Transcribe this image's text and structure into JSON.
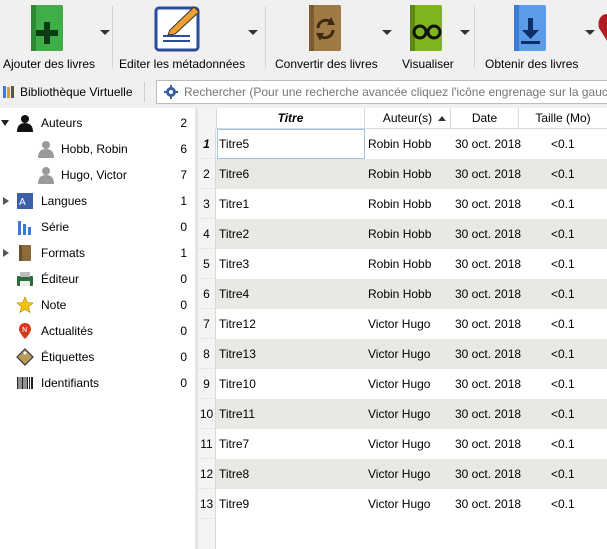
{
  "toolbar": {
    "add_label": "Ajouter des livres",
    "edit_label": "Editer les métadonnées",
    "convert_label": "Convertir des livres",
    "view_label": "Visualiser",
    "get_label": "Obtenir des livres"
  },
  "search": {
    "vlib_label": "Bibliothèque Virtuelle",
    "placeholder": "Rechercher (Pour une recherche avancée cliquez l'icône engrenage sur la gauche)"
  },
  "sidebar": {
    "items": [
      {
        "label": "Auteurs",
        "count": "2",
        "expanded": true,
        "icon": "person-icon"
      },
      {
        "label": "Hobb, Robin",
        "count": "6",
        "child": true,
        "icon": "person-gray-icon"
      },
      {
        "label": "Hugo, Victor",
        "count": "7",
        "child": true,
        "icon": "person-gray-icon"
      },
      {
        "label": "Langues",
        "count": "1",
        "icon": "language-icon"
      },
      {
        "label": "Série",
        "count": "0",
        "icon": "series-icon"
      },
      {
        "label": "Formats",
        "count": "1",
        "icon": "book-icon"
      },
      {
        "label": "Éditeur",
        "count": "0",
        "icon": "publisher-icon"
      },
      {
        "label": "Note",
        "count": "0",
        "icon": "star-icon"
      },
      {
        "label": "Actualités",
        "count": "0",
        "icon": "news-icon"
      },
      {
        "label": "Étiquettes",
        "count": "0",
        "icon": "tag-icon"
      },
      {
        "label": "Identifiants",
        "count": "0",
        "icon": "barcode-icon"
      }
    ]
  },
  "table": {
    "headers": {
      "title": "Titre",
      "author": "Auteur(s)",
      "date": "Date",
      "size": "Taille (Mo)"
    },
    "rows": [
      {
        "num": "1",
        "title": "Titre5",
        "author": "Robin Hobb",
        "date": "30 oct. 2018",
        "size": "<0.1"
      },
      {
        "num": "2",
        "title": "Titre6",
        "author": "Robin Hobb",
        "date": "30 oct. 2018",
        "size": "<0.1"
      },
      {
        "num": "3",
        "title": "Titre1",
        "author": "Robin Hobb",
        "date": "30 oct. 2018",
        "size": "<0.1"
      },
      {
        "num": "4",
        "title": "Titre2",
        "author": "Robin Hobb",
        "date": "30 oct. 2018",
        "size": "<0.1"
      },
      {
        "num": "5",
        "title": "Titre3",
        "author": "Robin Hobb",
        "date": "30 oct. 2018",
        "size": "<0.1"
      },
      {
        "num": "6",
        "title": "Titre4",
        "author": "Robin Hobb",
        "date": "30 oct. 2018",
        "size": "<0.1"
      },
      {
        "num": "7",
        "title": "Titre12",
        "author": "Victor Hugo",
        "date": "30 oct. 2018",
        "size": "<0.1"
      },
      {
        "num": "8",
        "title": "Titre13",
        "author": "Victor Hugo",
        "date": "30 oct. 2018",
        "size": "<0.1"
      },
      {
        "num": "9",
        "title": "Titre10",
        "author": "Victor Hugo",
        "date": "30 oct. 2018",
        "size": "<0.1"
      },
      {
        "num": "10",
        "title": "Titre11",
        "author": "Victor Hugo",
        "date": "30 oct. 2018",
        "size": "<0.1"
      },
      {
        "num": "11",
        "title": "Titre7",
        "author": "Victor Hugo",
        "date": "30 oct. 2018",
        "size": "<0.1"
      },
      {
        "num": "12",
        "title": "Titre8",
        "author": "Victor Hugo",
        "date": "30 oct. 2018",
        "size": "<0.1"
      },
      {
        "num": "13",
        "title": "Titre9",
        "author": "Victor Hugo",
        "date": "30 oct. 2018",
        "size": "<0.1"
      }
    ]
  },
  "colors": {
    "accent_green": "#3fae49",
    "edit_blue": "#2a4d9b",
    "convert_brown": "#8c6a3b",
    "view_green": "#7fb41f",
    "get_blue": "#3a7bd5",
    "alt_row": "#e9e8e4"
  }
}
